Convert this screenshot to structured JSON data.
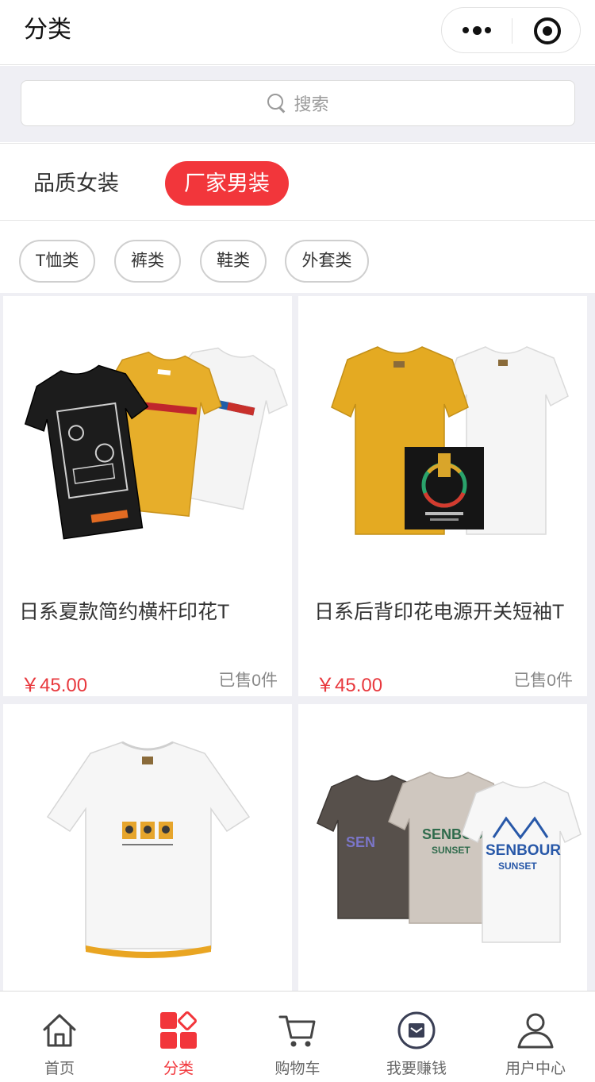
{
  "navbar": {
    "title": "分类"
  },
  "search": {
    "placeholder": "搜索"
  },
  "tabs": [
    {
      "label": "品质女装",
      "active": false
    },
    {
      "label": "厂家男装",
      "active": true
    }
  ],
  "chips": [
    "T恤类",
    "裤类",
    "鞋类",
    "外套类"
  ],
  "products": [
    {
      "name": "日系夏款简约横杆印花T",
      "price": "￥45.00",
      "sold": "已售0件"
    },
    {
      "name": "日系后背印花电源开关短袖T",
      "price": "￥45.00",
      "sold": "已售0件"
    },
    {
      "name": "",
      "price": "",
      "sold": ""
    },
    {
      "name": "",
      "price": "",
      "sold": ""
    }
  ],
  "tabbar": [
    {
      "label": "首页",
      "icon": "home-icon",
      "active": false
    },
    {
      "label": "分类",
      "icon": "category-grid-icon",
      "active": true
    },
    {
      "label": "购物车",
      "icon": "cart-icon",
      "active": false
    },
    {
      "label": "我要赚钱",
      "icon": "earn-money-icon",
      "active": false
    },
    {
      "label": "用户中心",
      "icon": "user-icon",
      "active": false
    }
  ],
  "colors": {
    "accent": "#f2363b",
    "price": "#e8383d",
    "page_bg": "#efeff4"
  }
}
